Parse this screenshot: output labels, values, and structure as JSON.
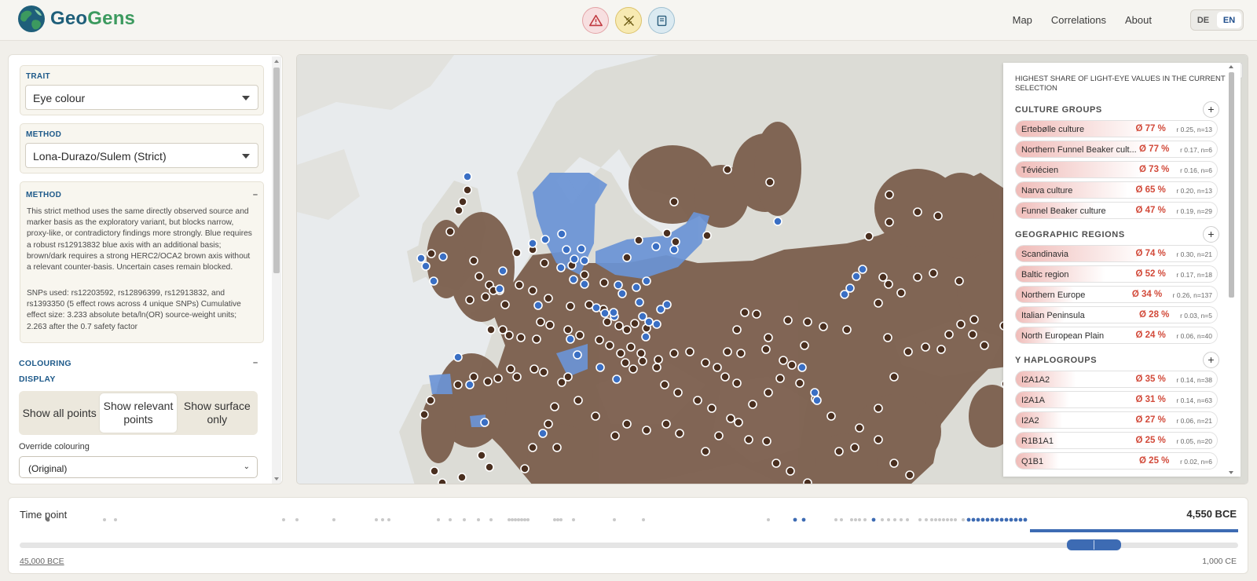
{
  "app": {
    "brand_geo": "Geo",
    "brand_gens": "Gens"
  },
  "nav": {
    "map": "Map",
    "correlations": "Correlations",
    "about": "About"
  },
  "lang": {
    "de": "DE",
    "en": "EN",
    "active": "EN"
  },
  "left": {
    "trait_label": "TRAIT",
    "trait_value": "Eye colour",
    "method_label": "METHOD",
    "method_value": "Lona-Durazo/Sulem (Strict)",
    "method_info_label": "METHOD",
    "method_info_toggle": "–",
    "method_description": "This strict method uses the same directly observed source and marker basis as the exploratory variant, but blocks narrow, proxy-like, or contradictory findings more strongly. Blue requires a robust rs12913832 blue axis with an additional basis; brown/dark requires a strong HERC2/OCA2 brown axis without a relevant counter-basis. Uncertain cases remain blocked.",
    "snps_text": "SNPs used: rs12203592, rs12896399, rs12913832, and rs1393350 (5 effect rows across 4 unique SNPs) Cumulative effect size: 3.233 absolute beta/ln(OR) source-weight units; 2.263 after the 0.7 safety factor",
    "colouring_label": "COLOURING",
    "colouring_toggle": "–",
    "display_label": "DISPLAY",
    "display_options": [
      "Show all points",
      "Show relevant points",
      "Show surface only"
    ],
    "display_active": "Show relevant points",
    "override_label": "Override colouring",
    "override_value": "(Original)"
  },
  "legend": {
    "title": "HIGHEST SHARE OF LIGHT-EYE VALUES IN THE CURRENT SELECTION",
    "sections": [
      {
        "name": "CULTURE GROUPS",
        "rows": [
          {
            "name": "Ertebølle culture",
            "pct": "Ø 77 %",
            "stat": "r 0.25, n=13",
            "share": 77
          },
          {
            "name": "Northern Funnel Beaker cult...",
            "pct": "Ø 77 %",
            "stat": "r 0.17, n=6",
            "share": 77
          },
          {
            "name": "Téviécien",
            "pct": "Ø 73 %",
            "stat": "r 0.16, n=6",
            "share": 73
          },
          {
            "name": "Narva culture",
            "pct": "Ø 65 %",
            "stat": "r 0.20, n=13",
            "share": 65
          },
          {
            "name": "Funnel Beaker culture",
            "pct": "Ø 47 %",
            "stat": "r 0.19, n=29",
            "share": 47
          }
        ]
      },
      {
        "name": "GEOGRAPHIC REGIONS",
        "rows": [
          {
            "name": "Scandinavia",
            "pct": "Ø 74 %",
            "stat": "r 0.30, n=21",
            "share": 74
          },
          {
            "name": "Baltic region",
            "pct": "Ø 52 %",
            "stat": "r 0.17, n=18",
            "share": 52
          },
          {
            "name": "Northern Europe",
            "pct": "Ø 34 %",
            "stat": "r 0.26, n=137",
            "share": 34
          },
          {
            "name": "Italian Peninsula",
            "pct": "Ø 28 %",
            "stat": "r 0.03, n=5",
            "share": 28
          },
          {
            "name": "North European Plain",
            "pct": "Ø 24 %",
            "stat": "r 0.06, n=40",
            "share": 24
          }
        ]
      },
      {
        "name": "Y HAPLOGROUPS",
        "rows": [
          {
            "name": "I2A1A2",
            "pct": "Ø 35 %",
            "stat": "r 0.14, n=38",
            "share": 35
          },
          {
            "name": "I2A1A",
            "pct": "Ø 31 %",
            "stat": "r 0.14, n=63",
            "share": 31
          },
          {
            "name": "I2A2",
            "pct": "Ø 27 %",
            "stat": "r 0.06, n=21",
            "share": 27
          },
          {
            "name": "R1B1A1",
            "pct": "Ø 25 %",
            "stat": "r 0.05, n=20",
            "share": 25
          },
          {
            "name": "Q1B1",
            "pct": "Ø 25 %",
            "stat": "r 0.02, n=6",
            "share": 25
          }
        ]
      }
    ]
  },
  "timeline": {
    "label": "Time point",
    "current": "4,550 BCE",
    "min": "45,000 BCE",
    "max": "1,000 CE"
  },
  "colors": {
    "brown": "#7b5e4c",
    "blue": "#6b94d6",
    "dot_brown": "#4a2f1f",
    "dot_blue": "#3a6fc4",
    "accent": "#1e5a8a",
    "pct_red": "#d24a3a"
  }
}
